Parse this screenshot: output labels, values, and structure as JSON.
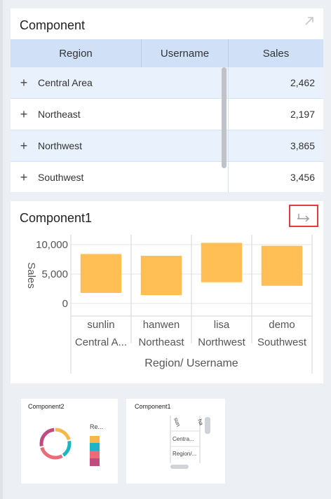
{
  "table_card": {
    "title": "Component",
    "columns": [
      "Region",
      "Username",
      "Sales"
    ],
    "rows": [
      {
        "region": "Central Area",
        "username": "",
        "sales": "2,462"
      },
      {
        "region": "Northeast",
        "username": "",
        "sales": "2,197"
      },
      {
        "region": "Northwest",
        "username": "",
        "sales": "3,865"
      },
      {
        "region": "Southwest",
        "username": "",
        "sales": "3,456"
      }
    ],
    "expand_glyph": "+",
    "open_icon": "open-in-new-icon"
  },
  "chart_card": {
    "title": "Component1",
    "share_icon": "switch-chart-icon",
    "highlight_color": "#e03b3b"
  },
  "chart_data": {
    "type": "bar",
    "subtype": "floating-range",
    "categories": [
      {
        "username": "sunlin",
        "region": "Central A..."
      },
      {
        "username": "hanwen",
        "region": "Northeast"
      },
      {
        "username": "lisa",
        "region": "Northwest"
      },
      {
        "username": "demo",
        "region": "Southwest"
      }
    ],
    "ranges": [
      [
        1800,
        8400
      ],
      [
        1400,
        8100
      ],
      [
        3600,
        10300
      ],
      [
        3000,
        9800
      ]
    ],
    "yticks": [
      "10,000",
      "5,000",
      "0"
    ],
    "ytick_values": [
      10000,
      5000,
      0
    ],
    "ylabel": "Sales",
    "xlabel": "Region/ Username",
    "ylim": [
      0,
      10000
    ],
    "color": "#ffbf55",
    "grid": true
  },
  "thumbnails": [
    {
      "title": "Component2",
      "kind": "donut",
      "legend_label": "Re...",
      "colors": [
        "#f7b84b",
        "#1cb5c4",
        "#ea6b79",
        "#c04b7e"
      ]
    },
    {
      "title": "Component1",
      "kind": "table",
      "labels": [
        "sun",
        "ha",
        "Centra...",
        "Region/..."
      ]
    }
  ]
}
